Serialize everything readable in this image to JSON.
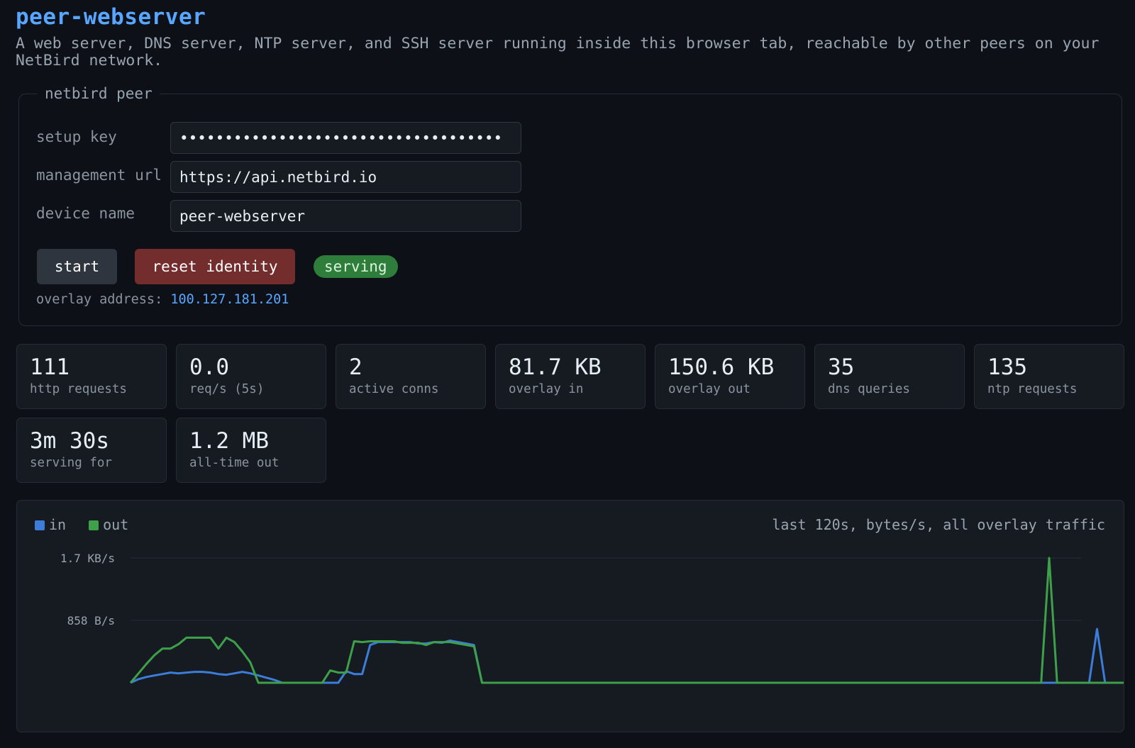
{
  "header": {
    "title": "peer-webserver",
    "subtitle": "A web server, DNS server, NTP server, and SSH server running inside this browser tab, reachable by other peers on your NetBird network."
  },
  "peer": {
    "legend": "netbird peer",
    "setup_key_label": "setup key",
    "setup_key_value": "••••••••••••••••••••••••••••••••••••",
    "management_url_label": "management url",
    "management_url_value": "https://api.netbird.io",
    "device_name_label": "device name",
    "device_name_value": "peer-webserver",
    "start_label": "start",
    "reset_label": "reset identity",
    "status": "serving",
    "overlay_label": "overlay address:",
    "overlay_address": "100.127.181.201"
  },
  "stats": [
    {
      "value": "111",
      "label": "http requests"
    },
    {
      "value": "0.0",
      "label": "req/s (5s)"
    },
    {
      "value": "2",
      "label": "active conns"
    },
    {
      "value": "81.7 KB",
      "label": "overlay in"
    },
    {
      "value": "150.6 KB",
      "label": "overlay out"
    },
    {
      "value": "35",
      "label": "dns queries"
    },
    {
      "value": "135",
      "label": "ntp requests"
    },
    {
      "value": "3m 30s",
      "label": "serving for"
    },
    {
      "value": "1.2 MB",
      "label": "all-time out"
    }
  ],
  "colors": {
    "accent": "#58a6ff",
    "in": "#3b7dd8",
    "out": "#3fa04a",
    "serving_badge": "#2e7d3a",
    "reset_button": "#732d2d"
  },
  "chart_data": {
    "type": "line",
    "legend": [
      "in",
      "out"
    ],
    "caption": "last 120s, bytes/s, all overlay traffic",
    "y_tick_labels": [
      "1.7 KB/s",
      "858 B/s"
    ],
    "ylim": [
      0,
      1716
    ],
    "x": [
      0,
      1,
      2,
      3,
      4,
      5,
      6,
      7,
      8,
      9,
      10,
      11,
      12,
      13,
      14,
      15,
      16,
      17,
      18,
      19,
      20,
      21,
      22,
      23,
      24,
      25,
      26,
      27,
      28,
      29,
      30,
      31,
      32,
      33,
      34,
      35,
      36,
      37,
      38,
      39,
      40,
      41,
      42,
      43,
      44,
      45,
      46,
      47,
      48,
      49,
      50,
      51,
      52,
      53,
      54,
      55,
      56,
      57,
      58,
      59,
      60,
      61,
      62,
      63,
      64,
      65,
      66,
      67,
      68,
      69,
      70,
      71,
      72,
      73,
      74,
      75,
      76,
      77,
      78,
      79,
      80,
      81,
      82,
      83,
      84,
      85,
      86,
      87,
      88,
      89,
      90,
      91,
      92,
      93,
      94,
      95,
      96,
      97,
      98,
      99,
      100,
      101,
      102,
      103,
      104,
      105,
      106,
      107,
      108,
      109,
      110,
      111,
      112,
      113,
      114,
      115,
      116,
      117,
      118,
      119
    ],
    "series": [
      {
        "name": "in",
        "values": [
          0,
          50,
          80,
          100,
          120,
          140,
          130,
          140,
          150,
          150,
          140,
          120,
          110,
          130,
          150,
          130,
          100,
          70,
          40,
          0,
          0,
          0,
          0,
          0,
          0,
          0,
          0,
          160,
          120,
          120,
          520,
          560,
          560,
          560,
          560,
          560,
          540,
          540,
          560,
          550,
          580,
          560,
          540,
          520,
          0,
          0,
          0,
          0,
          0,
          0,
          0,
          0,
          0,
          0,
          0,
          0,
          0,
          0,
          0,
          0,
          0,
          0,
          0,
          0,
          0,
          0,
          0,
          0,
          0,
          0,
          0,
          0,
          0,
          0,
          0,
          0,
          0,
          0,
          0,
          0,
          0,
          0,
          0,
          0,
          0,
          0,
          0,
          0,
          0,
          0,
          0,
          0,
          0,
          0,
          0,
          0,
          0,
          0,
          0,
          0,
          0,
          0,
          0,
          0,
          0,
          0,
          0,
          0,
          0,
          0,
          0,
          0,
          0,
          0,
          0,
          0,
          0,
          0,
          0,
          0,
          0,
          740,
          0,
          0,
          0,
          0,
          0,
          0,
          0,
          0,
          0,
          0,
          0,
          0,
          0,
          0
        ]
      },
      {
        "name": "out",
        "values": [
          0,
          130,
          260,
          380,
          470,
          470,
          530,
          620,
          620,
          620,
          620,
          470,
          620,
          560,
          430,
          280,
          0,
          0,
          0,
          0,
          0,
          0,
          0,
          0,
          0,
          170,
          140,
          140,
          570,
          560,
          570,
          570,
          570,
          570,
          550,
          550,
          550,
          520,
          560,
          560,
          560,
          540,
          520,
          500,
          0,
          0,
          0,
          0,
          0,
          0,
          0,
          0,
          0,
          0,
          0,
          0,
          0,
          0,
          0,
          0,
          0,
          0,
          0,
          0,
          0,
          0,
          0,
          0,
          0,
          0,
          0,
          0,
          0,
          0,
          0,
          0,
          0,
          0,
          0,
          0,
          0,
          0,
          0,
          0,
          0,
          0,
          0,
          0,
          0,
          0,
          0,
          0,
          0,
          0,
          0,
          0,
          0,
          0,
          0,
          0,
          0,
          0,
          0,
          0,
          0,
          0,
          0,
          0,
          0,
          0,
          0,
          0,
          0,
          0,
          0,
          1716,
          0,
          0,
          0,
          0,
          0,
          0,
          0,
          0,
          0,
          0,
          0,
          0,
          0,
          0
        ]
      }
    ]
  }
}
